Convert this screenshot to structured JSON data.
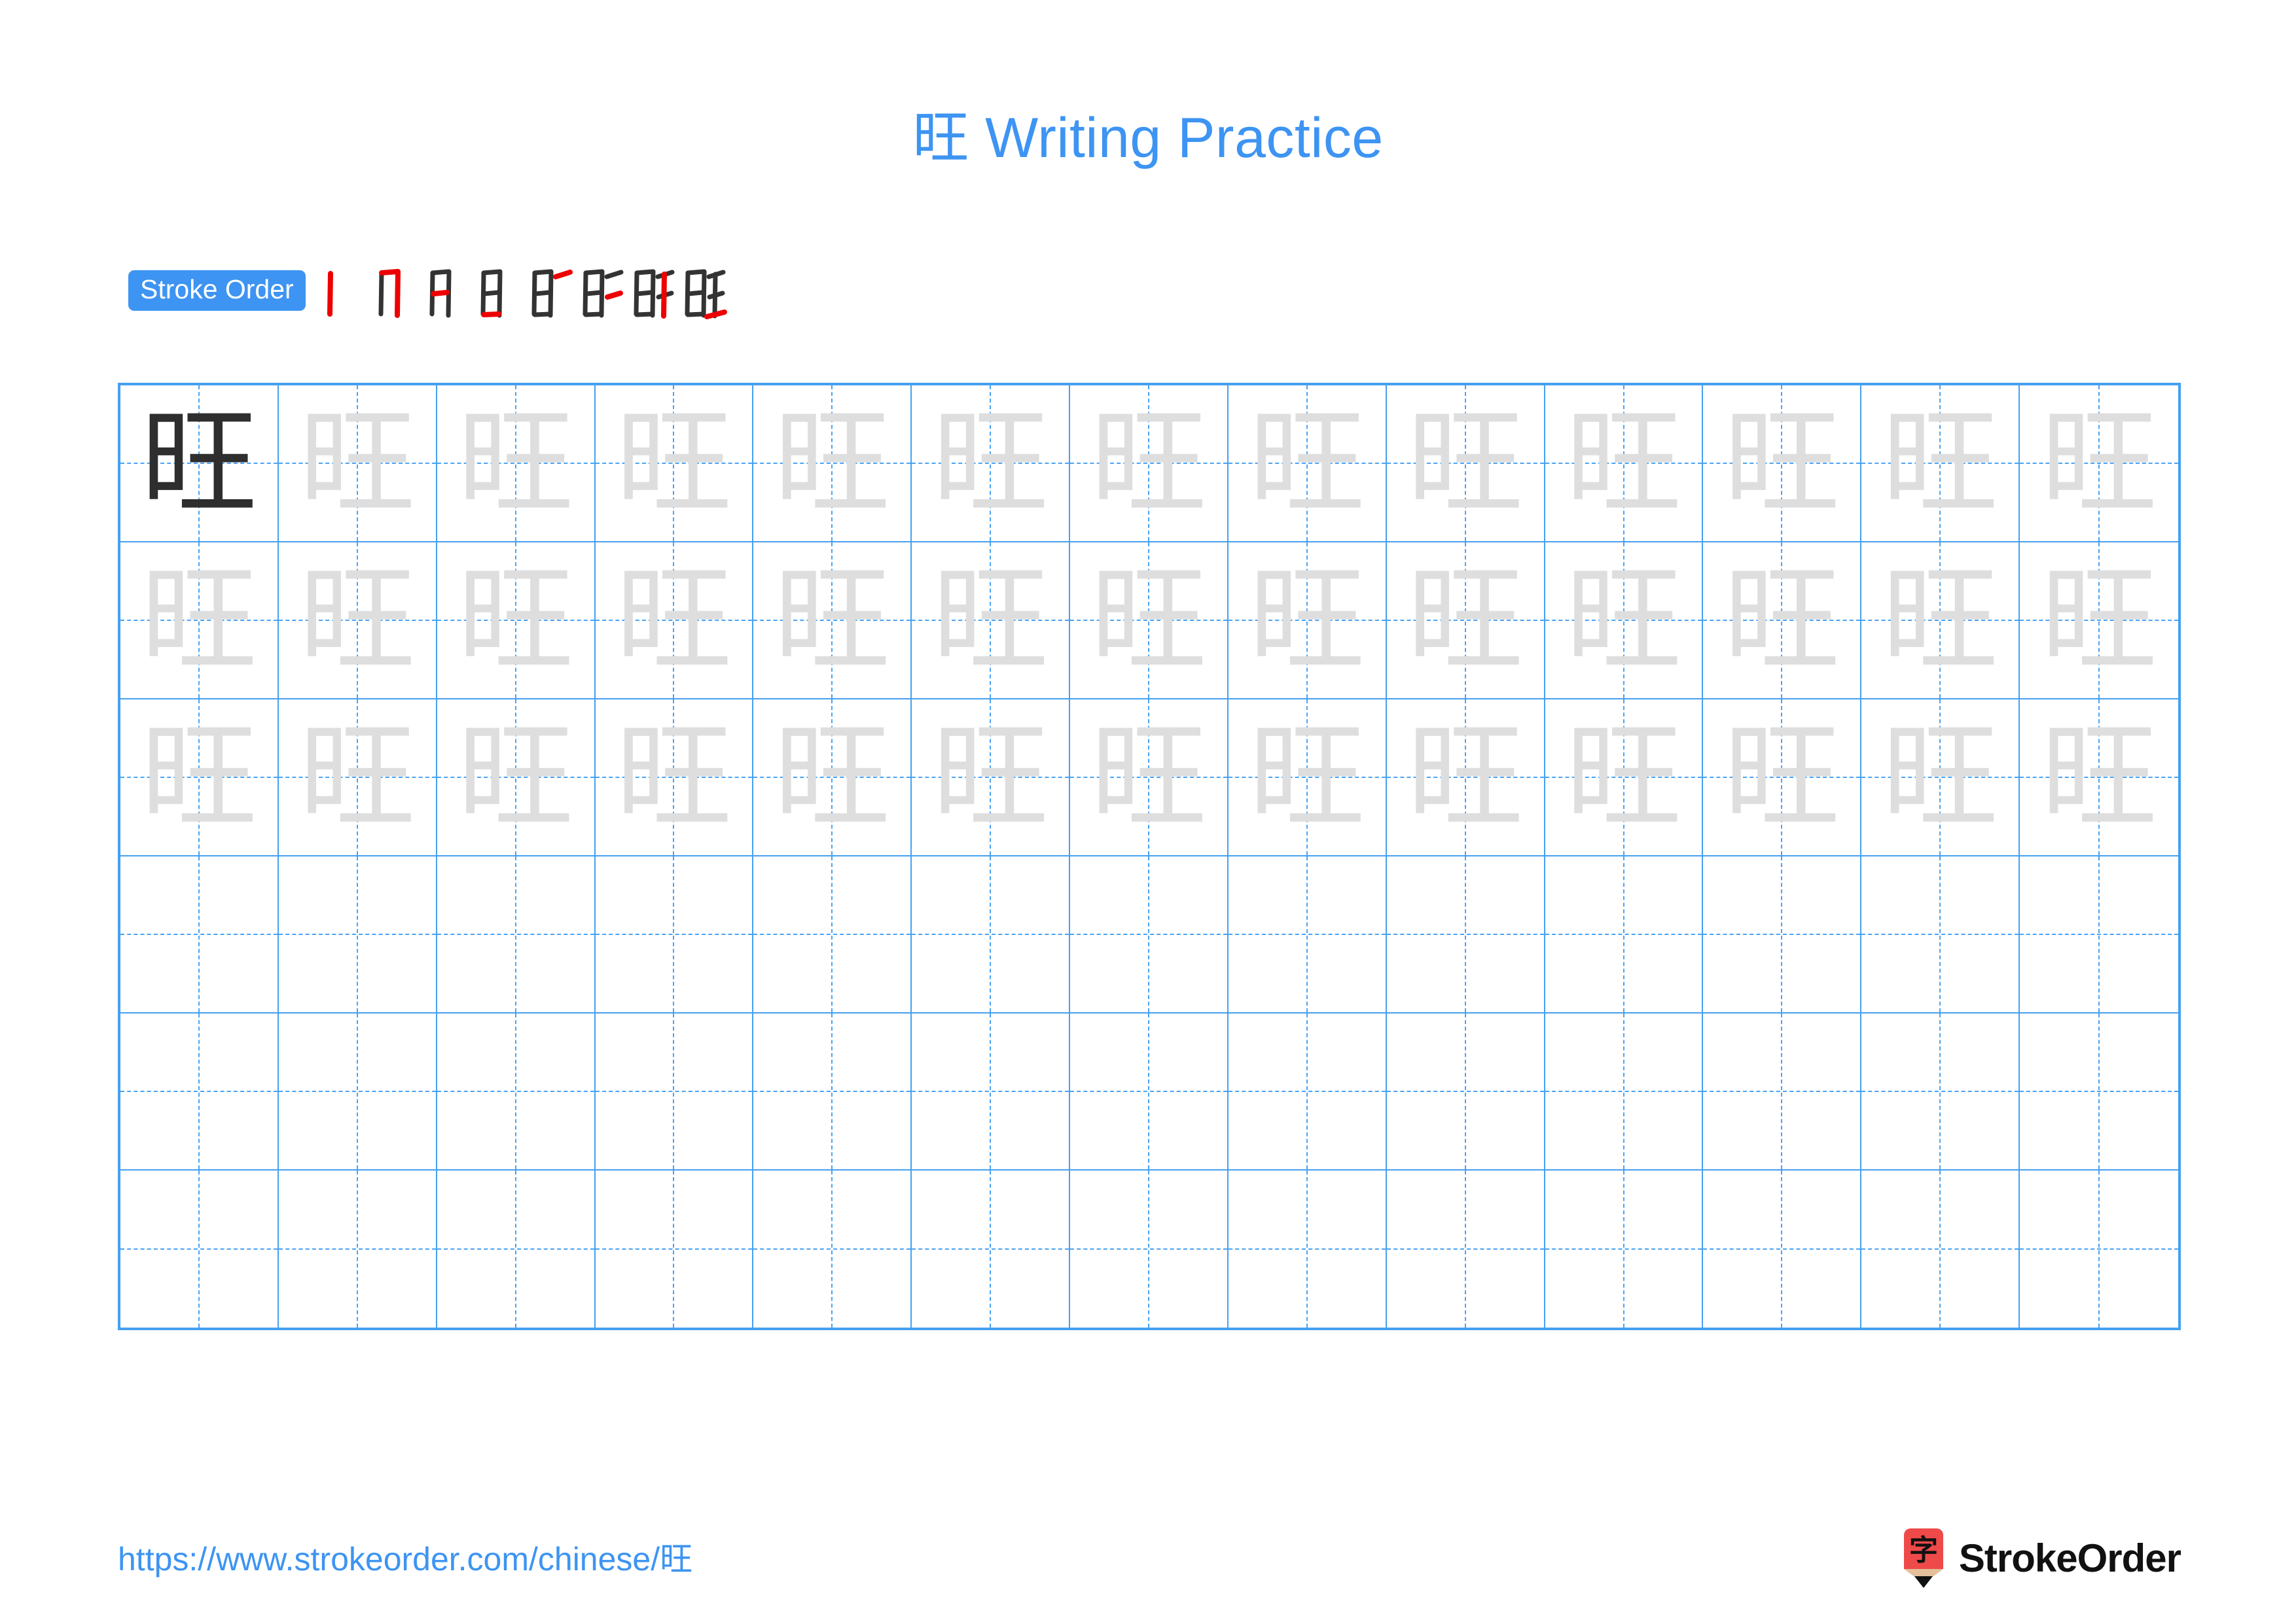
{
  "page": {
    "character": "旺",
    "title_suffix": " Writing Practice",
    "title_full": "旺 Writing Practice",
    "accent_color": "#3d94f2",
    "grid_line_color": "#45a0f0",
    "guide_line_color": "#4aa3f3",
    "dark_glyph_color": "#2e2e2e",
    "faint_glyph_color": "#dedede",
    "stroke_new_color": "#ee0000",
    "stroke_done_color": "#333333"
  },
  "stroke_order": {
    "badge_label": "Stroke Order",
    "total_strokes": 8,
    "steps": [
      {
        "index": 1,
        "name": "stroke-step-1",
        "new_stroke": "vertical (丨) left side of 日"
      },
      {
        "index": 2,
        "name": "stroke-step-2",
        "new_stroke": "horizontal-bend-vertical (㇆) enclosing right of 日"
      },
      {
        "index": 3,
        "name": "stroke-step-3",
        "new_stroke": "horizontal (一) middle of 日"
      },
      {
        "index": 4,
        "name": "stroke-step-4",
        "new_stroke": "horizontal (一) bottom closing 日"
      },
      {
        "index": 5,
        "name": "stroke-step-5",
        "new_stroke": "horizontal (一) top of 王"
      },
      {
        "index": 6,
        "name": "stroke-step-6",
        "new_stroke": "horizontal (一) middle of 王"
      },
      {
        "index": 7,
        "name": "stroke-step-7",
        "new_stroke": "vertical (丨) center of 王"
      },
      {
        "index": 8,
        "name": "stroke-step-8",
        "new_stroke": "horizontal (一) bottom of 王"
      }
    ]
  },
  "practice_grid": {
    "columns": 13,
    "rows": 6,
    "model_cell": {
      "row": 1,
      "column": 1,
      "style": "dark"
    },
    "traced_rows": [
      1,
      2,
      3
    ],
    "blank_rows": [
      4,
      5,
      6
    ],
    "cells": [
      [
        "dark",
        "faint",
        "faint",
        "faint",
        "faint",
        "faint",
        "faint",
        "faint",
        "faint",
        "faint",
        "faint",
        "faint",
        "faint"
      ],
      [
        "faint",
        "faint",
        "faint",
        "faint",
        "faint",
        "faint",
        "faint",
        "faint",
        "faint",
        "faint",
        "faint",
        "faint",
        "faint"
      ],
      [
        "faint",
        "faint",
        "faint",
        "faint",
        "faint",
        "faint",
        "faint",
        "faint",
        "faint",
        "faint",
        "faint",
        "faint",
        "faint"
      ],
      [
        "",
        "",
        "",
        "",
        "",
        "",
        "",
        "",
        "",
        "",
        "",
        "",
        ""
      ],
      [
        "",
        "",
        "",
        "",
        "",
        "",
        "",
        "",
        "",
        "",
        "",
        "",
        ""
      ],
      [
        "",
        "",
        "",
        "",
        "",
        "",
        "",
        "",
        "",
        "",
        "",
        "",
        ""
      ]
    ]
  },
  "footer": {
    "url": "https://www.strokeorder.com/chinese/旺",
    "url_prefix": "https://www.strokeorder.com/chinese/",
    "brand_name": "StrokeOrder",
    "logo_character": "字",
    "logo_body_color": "#ef4a4a",
    "logo_wood_color": "#e3c09a",
    "logo_tip_color": "#111111"
  }
}
